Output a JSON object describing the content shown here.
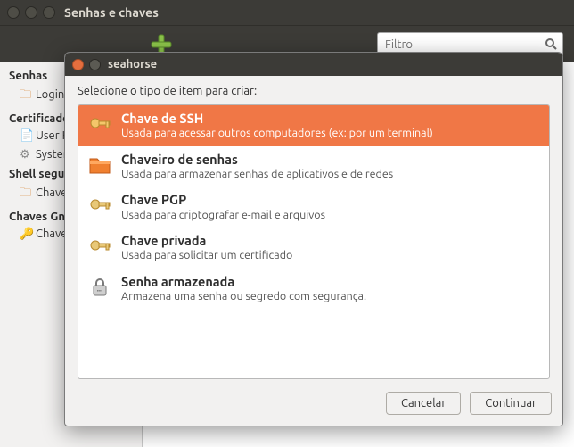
{
  "main_window": {
    "title": "Senhas e chaves",
    "filter_placeholder": "Filtro"
  },
  "sidebar": {
    "groups": [
      {
        "heading": "Senhas",
        "items": [
          {
            "icon": "folder",
            "label": "Login"
          }
        ]
      },
      {
        "heading": "Certificados",
        "items": [
          {
            "icon": "cert",
            "label": "User Key Storage: sample"
          },
          {
            "icon": "gear",
            "label": "System Trust: sample"
          }
        ]
      },
      {
        "heading": "Shell seguro",
        "items": [
          {
            "icon": "folder",
            "label": "Chaves OpenSSH: ~"
          }
        ]
      },
      {
        "heading": "Chaves GnuPG",
        "items": [
          {
            "icon": "key",
            "label": "Chaves GnuPG: sample"
          }
        ]
      }
    ]
  },
  "dialog": {
    "title": "seahorse",
    "prompt": "Selecione o tipo de item para criar:",
    "options": [
      {
        "id": "ssh-key",
        "selected": true,
        "icon": "key-gold",
        "title": "Chave de SSH",
        "desc": "Usada para acessar outros computadores (ex: por um terminal)"
      },
      {
        "id": "keyring",
        "selected": false,
        "icon": "folder-orng",
        "title": "Chaveiro de senhas",
        "desc": "Usada para armazenar senhas de aplicativos e de redes"
      },
      {
        "id": "pgp-key",
        "selected": false,
        "icon": "key-gold",
        "title": "Chave PGP",
        "desc": "Usada para criptografar e-mail e arquivos"
      },
      {
        "id": "private-key",
        "selected": false,
        "icon": "key-gold",
        "title": "Chave privada",
        "desc": "Usada para solicitar um certificado"
      },
      {
        "id": "stored-pass",
        "selected": false,
        "icon": "lock-gray",
        "title": "Senha armazenada",
        "desc": "Armazena uma senha ou segredo com segurança."
      }
    ],
    "buttons": {
      "cancel": "Cancelar",
      "continue": "Continuar"
    }
  }
}
